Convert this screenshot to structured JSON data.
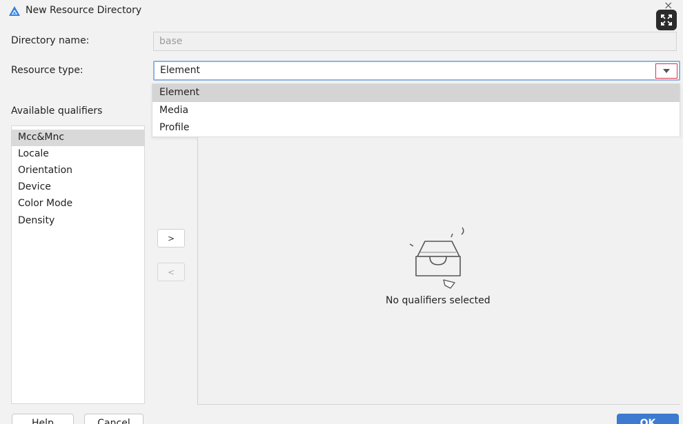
{
  "window": {
    "title": "New Resource Directory",
    "close_glyph": "×"
  },
  "form": {
    "directory_name_label": "Directory name:",
    "directory_name_placeholder": "base",
    "resource_type_label": "Resource type:",
    "resource_type_value": "Element",
    "available_qualifiers_label": "Available qualifiers"
  },
  "dropdown": {
    "options": [
      "Element",
      "Media",
      "Profile"
    ],
    "selected": "Element"
  },
  "qualifiers": {
    "available": [
      "Mcc&Mnc",
      "Locale",
      "Orientation",
      "Device",
      "Color Mode",
      "Density"
    ],
    "selected_item": "Mcc&Mnc",
    "empty_text": "No qualifiers selected"
  },
  "arrows": {
    "add": ">",
    "remove": "<"
  },
  "buttons": {
    "help": "Help",
    "cancel": "Cancel",
    "ok": "OK"
  },
  "colors": {
    "accent": "#3c7bd0",
    "focus_border": "#8cb4e3",
    "dropdown_highlight": "#d7314c"
  },
  "icons": {
    "app_logo": "app-logo-icon",
    "expand": "expand-icon",
    "dropdown": "chevron-down-icon",
    "empty": "empty-tray-icon"
  }
}
